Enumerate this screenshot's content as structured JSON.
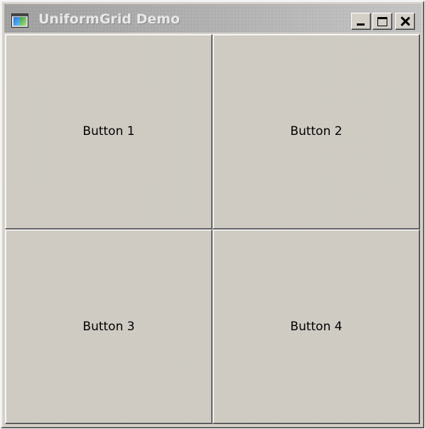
{
  "window": {
    "title": "UniformGrid Demo",
    "app_icon": "window-app-icon",
    "caption_buttons": {
      "minimize_icon": "minimize-icon",
      "maximize_icon": "maximize-icon",
      "close_icon": "close-icon"
    }
  },
  "grid": {
    "buttons": [
      {
        "label": "Button 1"
      },
      {
        "label": "Button 2"
      },
      {
        "label": "Button 3"
      },
      {
        "label": "Button 4"
      }
    ]
  },
  "colors": {
    "face": "#d4d0c8",
    "title_text": "#e8e8e8",
    "title_bar": "#a6a6a6"
  }
}
